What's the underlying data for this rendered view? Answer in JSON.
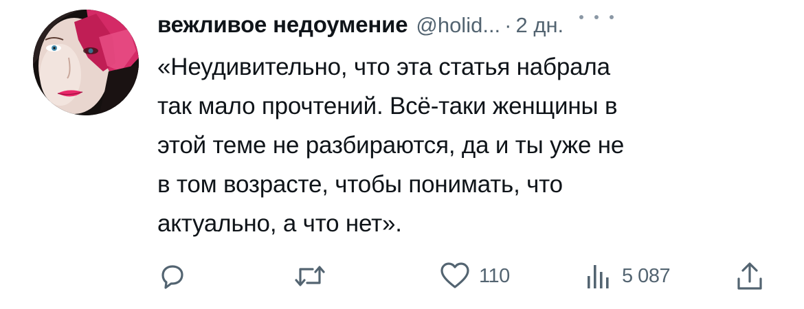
{
  "tweet": {
    "author": {
      "display_name": "вежливое недоумение",
      "handle": "@holid...",
      "avatar_icon": "avatar-portrait"
    },
    "separator": "·",
    "time": "2 дн.",
    "more_icon": "more-horizontal-icon",
    "text": "«Неудивительно, что эта статья набрала\nтак мало прочтений. Всё-таки женщины в\nэтой теме не разбираются, да и ты уже не\nв том возрасте, чтобы понимать, что\nактуально, а что нет».",
    "actions": {
      "reply": {
        "icon": "reply-icon",
        "count": ""
      },
      "retweet": {
        "icon": "retweet-icon",
        "count": ""
      },
      "like": {
        "icon": "heart-icon",
        "count": "110"
      },
      "views": {
        "icon": "views-chart-icon",
        "count": "5 087"
      },
      "share": {
        "icon": "share-icon"
      }
    }
  },
  "colors": {
    "text_primary": "#0f1419",
    "text_secondary": "#536471",
    "avatar_accent": "#e0306a"
  }
}
